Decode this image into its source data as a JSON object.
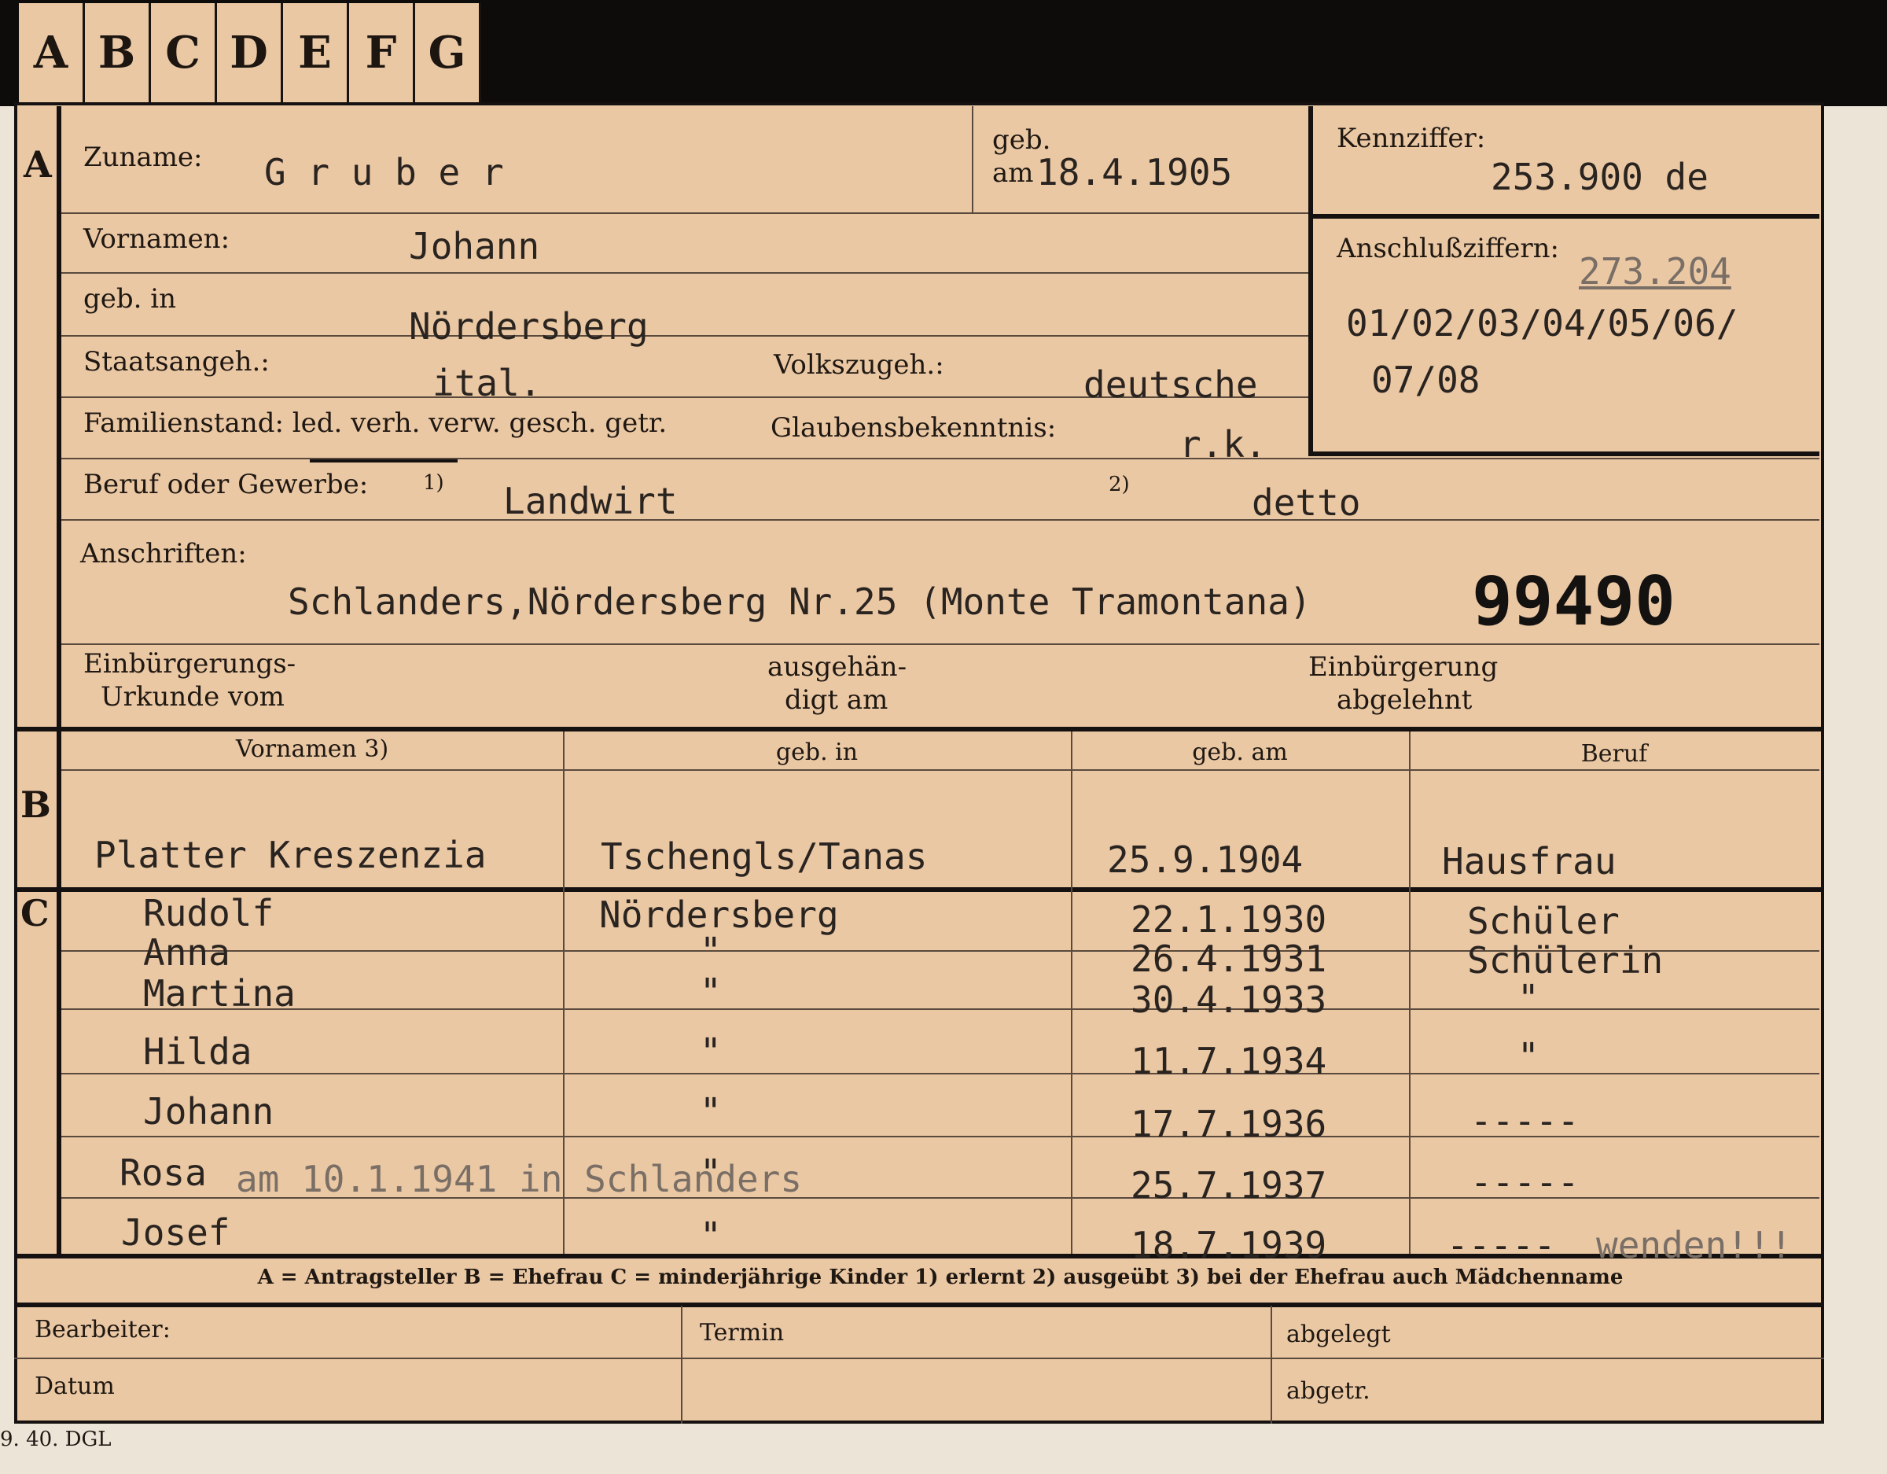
{
  "tabs": [
    "A",
    "B",
    "C",
    "D",
    "E",
    "F",
    "G"
  ],
  "section_letters": {
    "a": "A",
    "b": "B",
    "c": "C"
  },
  "labels": {
    "zuname": "Zuname:",
    "geb_am_top": "geb.",
    "geb_am_bottom": "am",
    "kennziffer": "Kennziffer:",
    "vornamen": "Vornamen:",
    "anschlussziffern": "Anschlußziffern:",
    "geb_in": "geb. in",
    "staatsangeh": "Staatsangeh.:",
    "volkszugeh": "Volkszugeh.:",
    "familienstand": "Familienstand: led. verh. verw. gesch. getr.",
    "glaubensbekenntnis": "Glaubensbekenntnis:",
    "beruf": "Beruf oder Gewerbe:",
    "fn1": "1)",
    "fn2": "2)",
    "anschriften": "Anschriften:",
    "einb_urkunde_1": "Einbürgerungs-",
    "einb_urkunde_2": "Urkunde vom",
    "ausgehaendigt_1": "ausgehän-",
    "ausgehaendigt_2": "digt am",
    "einb_abgelehnt_1": "Einbürgerung",
    "einb_abgelehnt_2": "abgelehnt"
  },
  "person": {
    "zuname": "G r u b e r",
    "geb_am": "18.4.1905",
    "kennziffer": "253.900   de",
    "vornamen": "Johann",
    "anschlussziffer_struck": "273.204",
    "anschlussziffern_line1": "01/02/03/04/05/06/",
    "anschlussziffern_line2": "07/08",
    "geb_in": "Nördersberg",
    "staatsangeh": "ital.",
    "volkszugeh": "deutsche",
    "glaubensbekenntnis": "r.k.",
    "beruf_erlernt": "Landwirt",
    "beruf_ausgeuebt": "detto",
    "anschrift": "Schlanders,Nördersberg Nr.25 (Monte Tramontana)",
    "stamp_number": "99490"
  },
  "table_headers": {
    "vornamen": "Vornamen 3)",
    "geb_in": "geb. in",
    "geb_am": "geb. am",
    "beruf": "Beruf"
  },
  "spouse": {
    "name": "Platter Kreszenzia",
    "geb_in": "Tschengls/Tanas",
    "geb_am": "25.9.1904",
    "beruf": "Hausfrau"
  },
  "children": [
    {
      "name": "Rudolf",
      "geb_in": "Nördersberg",
      "geb_am": "22.1.1930",
      "beruf": "Schüler"
    },
    {
      "name": "Anna",
      "geb_in": "\"",
      "geb_am": "26.4.1931",
      "beruf": "Schülerin"
    },
    {
      "name": "Martina",
      "geb_in": "\"",
      "geb_am": "30.4.1933",
      "beruf": "\""
    },
    {
      "name": "Hilda",
      "geb_in": "\"",
      "geb_am": "11.7.1934",
      "beruf": "\""
    },
    {
      "name": "Johann",
      "geb_in": "\"",
      "geb_am": "17.7.1936",
      "beruf": "-----"
    },
    {
      "name": "Rosa",
      "geb_in": "\"",
      "geb_am": "25.7.1937",
      "beruf": "-----"
    },
    {
      "name": "Josef",
      "geb_in": "\"",
      "geb_am": "18.7.1939",
      "beruf": "-----"
    }
  ],
  "annotations": {
    "rosa_note": "am 10.1.1941 in Schlanders",
    "wenden": "wenden!!!"
  },
  "legend": "A = Antragsteller   B = Ehefrau   C = minderjährige Kinder   1) erlernt   2) ausgeübt   3) bei der Ehefrau auch Mädchenname",
  "footer": {
    "bearbeiter": "Bearbeiter:",
    "datum": "Datum",
    "termin": "Termin",
    "abgelegt": "abgelegt",
    "abgetr": "abgetr."
  },
  "print_code": "9. 40. DGL"
}
